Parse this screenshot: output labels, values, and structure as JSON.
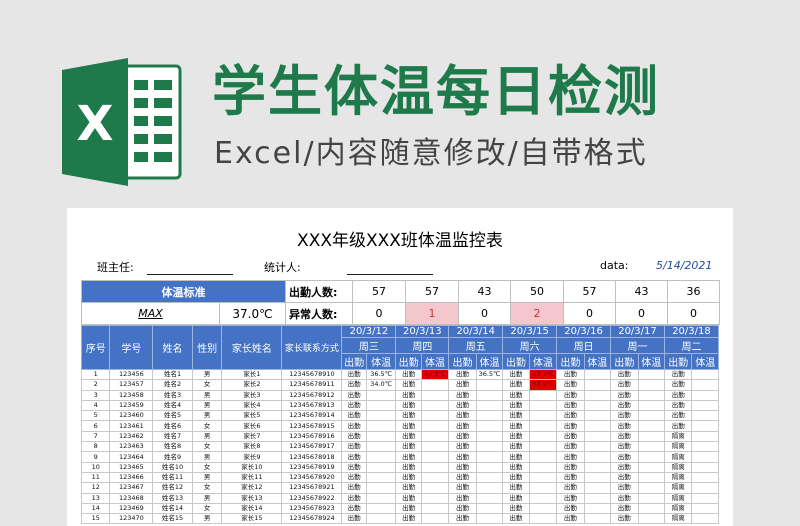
{
  "banner": {
    "title": "学生体温每日检测",
    "subtitle": "Excel/内容随意修改/自带格式",
    "logo_letter": "X"
  },
  "sheet": {
    "title": "XXX年级XXX班体温监控表",
    "teacher_label": "班主任:",
    "counter_label": "统计人:",
    "date_label": "data:",
    "date_value": "5/14/2021",
    "standard_label": "体温标准",
    "max_label": "MAX",
    "max_value": "37.0℃",
    "attendance_label": "出勤人数:",
    "abnormal_label": "异常人数:",
    "attendance_counts": [
      "57",
      "57",
      "43",
      "50",
      "57",
      "43",
      "36"
    ],
    "abnormal_counts": [
      "0",
      "1",
      "0",
      "2",
      "0",
      "0",
      "0"
    ],
    "abnormal_highlight": [
      false,
      true,
      false,
      true,
      false,
      false,
      false
    ],
    "headers": {
      "no": "序号",
      "id": "学号",
      "name": "姓名",
      "gender": "性别",
      "parent": "家长姓名",
      "contact": "家长联系方式",
      "attend": "出勤",
      "temp": "体温"
    },
    "days": [
      {
        "date": "20/3/12",
        "weekday": "周三"
      },
      {
        "date": "20/3/13",
        "weekday": "周四"
      },
      {
        "date": "20/3/14",
        "weekday": "周五"
      },
      {
        "date": "20/3/15",
        "weekday": "周六"
      },
      {
        "date": "20/3/16",
        "weekday": "周日"
      },
      {
        "date": "20/3/17",
        "weekday": "周一"
      },
      {
        "date": "20/3/18",
        "weekday": "周二"
      }
    ],
    "rows": [
      {
        "no": "1",
        "id": "123456",
        "name": "姓名1",
        "gender": "男",
        "parent": "家长1",
        "phone": "12345678910",
        "cells": [
          [
            "出勤",
            "36.5℃"
          ],
          [
            "出勤",
            "37.1℃"
          ],
          [
            "出勤",
            "36.5℃"
          ],
          [
            "出勤",
            "37.2℃"
          ],
          [
            "出勤",
            ""
          ],
          [
            "出勤",
            ""
          ],
          [
            "出勤",
            ""
          ]
        ]
      },
      {
        "no": "2",
        "id": "123457",
        "name": "姓名2",
        "gender": "女",
        "parent": "家长2",
        "phone": "12345678911",
        "cells": [
          [
            "出勤",
            "34.0℃"
          ],
          [
            "出勤",
            ""
          ],
          [
            "出勤",
            ""
          ],
          [
            "出勤",
            "37.9℃"
          ],
          [
            "出勤",
            ""
          ],
          [
            "出勤",
            ""
          ],
          [
            "出勤",
            ""
          ]
        ]
      },
      {
        "no": "3",
        "id": "123458",
        "name": "姓名3",
        "gender": "男",
        "parent": "家长3",
        "phone": "12345678912",
        "cells": [
          [
            "出勤",
            ""
          ],
          [
            "出勤",
            ""
          ],
          [
            "出勤",
            ""
          ],
          [
            "出勤",
            ""
          ],
          [
            "出勤",
            ""
          ],
          [
            "出勤",
            ""
          ],
          [
            "出勤",
            ""
          ]
        ]
      },
      {
        "no": "4",
        "id": "123459",
        "name": "姓名4",
        "gender": "男",
        "parent": "家长4",
        "phone": "12345678913",
        "cells": [
          [
            "出勤",
            ""
          ],
          [
            "出勤",
            ""
          ],
          [
            "出勤",
            ""
          ],
          [
            "出勤",
            ""
          ],
          [
            "出勤",
            ""
          ],
          [
            "出勤",
            ""
          ],
          [
            "出勤",
            ""
          ]
        ]
      },
      {
        "no": "5",
        "id": "123460",
        "name": "姓名5",
        "gender": "男",
        "parent": "家长5",
        "phone": "12345678914",
        "cells": [
          [
            "出勤",
            ""
          ],
          [
            "出勤",
            ""
          ],
          [
            "出勤",
            ""
          ],
          [
            "出勤",
            ""
          ],
          [
            "出勤",
            ""
          ],
          [
            "出勤",
            ""
          ],
          [
            "出勤",
            ""
          ]
        ]
      },
      {
        "no": "6",
        "id": "123461",
        "name": "姓名6",
        "gender": "女",
        "parent": "家长6",
        "phone": "12345678915",
        "cells": [
          [
            "出勤",
            ""
          ],
          [
            "出勤",
            ""
          ],
          [
            "出勤",
            ""
          ],
          [
            "出勤",
            ""
          ],
          [
            "出勤",
            ""
          ],
          [
            "出勤",
            ""
          ],
          [
            "出勤",
            ""
          ]
        ]
      },
      {
        "no": "7",
        "id": "123462",
        "name": "姓名7",
        "gender": "男",
        "parent": "家长7",
        "phone": "12345678916",
        "cells": [
          [
            "出勤",
            ""
          ],
          [
            "出勤",
            ""
          ],
          [
            "出勤",
            ""
          ],
          [
            "出勤",
            ""
          ],
          [
            "出勤",
            ""
          ],
          [
            "出勤",
            ""
          ],
          [
            "隔离",
            ""
          ]
        ]
      },
      {
        "no": "8",
        "id": "123463",
        "name": "姓名8",
        "gender": "女",
        "parent": "家长8",
        "phone": "12345678917",
        "cells": [
          [
            "出勤",
            ""
          ],
          [
            "出勤",
            ""
          ],
          [
            "出勤",
            ""
          ],
          [
            "出勤",
            ""
          ],
          [
            "出勤",
            ""
          ],
          [
            "出勤",
            ""
          ],
          [
            "隔离",
            ""
          ]
        ]
      },
      {
        "no": "9",
        "id": "123464",
        "name": "姓名9",
        "gender": "男",
        "parent": "家长9",
        "phone": "12345678918",
        "cells": [
          [
            "出勤",
            ""
          ],
          [
            "出勤",
            ""
          ],
          [
            "出勤",
            ""
          ],
          [
            "出勤",
            ""
          ],
          [
            "出勤",
            ""
          ],
          [
            "出勤",
            ""
          ],
          [
            "隔离",
            ""
          ]
        ]
      },
      {
        "no": "10",
        "id": "123465",
        "name": "姓名10",
        "gender": "女",
        "parent": "家长10",
        "phone": "12345678919",
        "cells": [
          [
            "出勤",
            ""
          ],
          [
            "出勤",
            ""
          ],
          [
            "出勤",
            ""
          ],
          [
            "出勤",
            ""
          ],
          [
            "出勤",
            ""
          ],
          [
            "出勤",
            ""
          ],
          [
            "隔离",
            ""
          ]
        ]
      },
      {
        "no": "11",
        "id": "123466",
        "name": "姓名11",
        "gender": "男",
        "parent": "家长11",
        "phone": "12345678920",
        "cells": [
          [
            "出勤",
            ""
          ],
          [
            "出勤",
            ""
          ],
          [
            "出勤",
            ""
          ],
          [
            "出勤",
            ""
          ],
          [
            "出勤",
            ""
          ],
          [
            "出勤",
            ""
          ],
          [
            "隔离",
            ""
          ]
        ]
      },
      {
        "no": "12",
        "id": "123467",
        "name": "姓名12",
        "gender": "女",
        "parent": "家长12",
        "phone": "12345678921",
        "cells": [
          [
            "出勤",
            ""
          ],
          [
            "出勤",
            ""
          ],
          [
            "出勤",
            ""
          ],
          [
            "出勤",
            ""
          ],
          [
            "出勤",
            ""
          ],
          [
            "出勤",
            ""
          ],
          [
            "隔离",
            ""
          ]
        ]
      },
      {
        "no": "13",
        "id": "123468",
        "name": "姓名13",
        "gender": "男",
        "parent": "家长13",
        "phone": "12345678922",
        "cells": [
          [
            "出勤",
            ""
          ],
          [
            "出勤",
            ""
          ],
          [
            "出勤",
            ""
          ],
          [
            "出勤",
            ""
          ],
          [
            "出勤",
            ""
          ],
          [
            "出勤",
            ""
          ],
          [
            "隔离",
            ""
          ]
        ]
      },
      {
        "no": "14",
        "id": "123469",
        "name": "姓名14",
        "gender": "女",
        "parent": "家长14",
        "phone": "12345678923",
        "cells": [
          [
            "出勤",
            ""
          ],
          [
            "出勤",
            ""
          ],
          [
            "出勤",
            ""
          ],
          [
            "出勤",
            ""
          ],
          [
            "出勤",
            ""
          ],
          [
            "出勤",
            ""
          ],
          [
            "隔离",
            ""
          ]
        ]
      },
      {
        "no": "15",
        "id": "123470",
        "name": "姓名15",
        "gender": "男",
        "parent": "家长15",
        "phone": "12345678924",
        "cells": [
          [
            "出勤",
            ""
          ],
          [
            "出勤",
            ""
          ],
          [
            "出勤",
            ""
          ],
          [
            "出勤",
            ""
          ],
          [
            "出勤",
            ""
          ],
          [
            "出勤",
            ""
          ],
          [
            "隔离",
            ""
          ]
        ]
      }
    ],
    "fever_cells": [
      [
        0,
        1
      ],
      [
        0,
        3
      ],
      [
        1,
        3
      ]
    ],
    "colors": {
      "brand_green": "#1e7a4a",
      "header_blue": "#4472c4",
      "fever_red": "#e00000",
      "abnormal_pink": "#f4c7cf"
    }
  }
}
